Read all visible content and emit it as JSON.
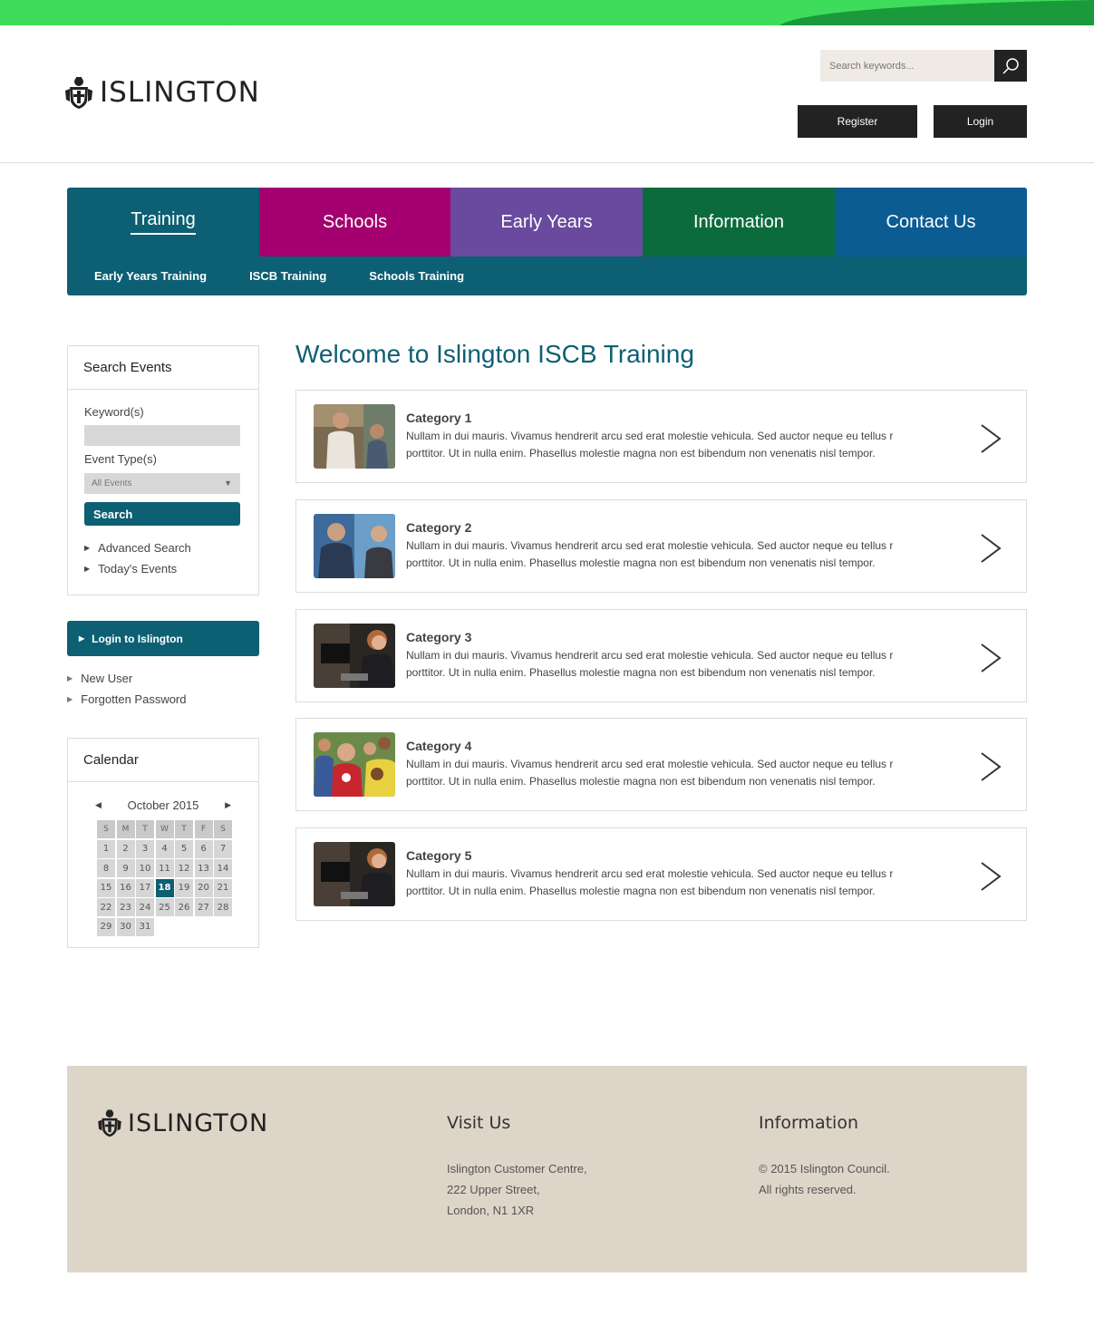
{
  "header": {
    "logo_text": "ISLINGTON",
    "search_placeholder": "Search keywords...",
    "register_label": "Register",
    "login_label": "Login"
  },
  "nav": {
    "tabs": [
      {
        "label": "Training",
        "color": "#0d5f73",
        "active": true
      },
      {
        "label": "Schools",
        "color": "#a4006f"
      },
      {
        "label": "Early Years",
        "color": "#6a4a9e"
      },
      {
        "label": "Information",
        "color": "#0c6b3d"
      },
      {
        "label": "Contact Us",
        "color": "#0c5c94"
      }
    ],
    "subnav": [
      "Early Years Training",
      "ISCB Training",
      "Schools Training"
    ]
  },
  "search_events": {
    "title": "Search Events",
    "keyword_label": "Keyword(s)",
    "event_type_label": "Event Type(s)",
    "event_type_value": "All Events",
    "search_button": "Search",
    "links": [
      "Advanced Search",
      "Today's Events"
    ]
  },
  "login_panel": {
    "button": "Login to Islington",
    "links": [
      "New User",
      "Forgotten Password"
    ]
  },
  "calendar": {
    "title": "Calendar",
    "month": "October 2015",
    "weekdays": [
      "S",
      "M",
      "T",
      "W",
      "T",
      "F",
      "S"
    ],
    "days": [
      "1",
      "2",
      "3",
      "4",
      "5",
      "6",
      "7",
      "8",
      "9",
      "10",
      "11",
      "12",
      "13",
      "14",
      "15",
      "16",
      "17",
      "18",
      "19",
      "20",
      "21",
      "22",
      "23",
      "24",
      "25",
      "26",
      "27",
      "28",
      "29",
      "30",
      "31"
    ],
    "selected_day": "18"
  },
  "main": {
    "title": "Welcome to Islington ISCB Training",
    "categories": [
      {
        "title": "Category 1",
        "desc": "Nullam in dui mauris. Vivamus hendrerit arcu sed erat molestie vehicula. Sed auctor neque eu tellus r porttitor. Ut in nulla enim. Phasellus molestie magna non est bibendum non venenatis nisl tempor."
      },
      {
        "title": "Category 2",
        "desc": "Nullam in dui mauris. Vivamus hendrerit arcu sed erat molestie vehicula. Sed auctor neque eu tellus r porttitor. Ut in nulla enim. Phasellus molestie magna non est bibendum non venenatis nisl tempor."
      },
      {
        "title": "Category 3",
        "desc": "Nullam in dui mauris. Vivamus hendrerit arcu sed erat molestie vehicula. Sed auctor neque eu tellus r porttitor. Ut in nulla enim. Phasellus molestie magna non est bibendum non venenatis nisl tempor."
      },
      {
        "title": "Category 4",
        "desc": "Nullam in dui mauris. Vivamus hendrerit arcu sed erat molestie vehicula. Sed auctor neque eu tellus r porttitor. Ut in nulla enim. Phasellus molestie magna non est bibendum non venenatis nisl tempor."
      },
      {
        "title": "Category 5",
        "desc": "Nullam in dui mauris. Vivamus hendrerit arcu sed erat molestie vehicula. Sed auctor neque eu tellus r porttitor. Ut in nulla enim. Phasellus molestie magna non est bibendum non venenatis nisl tempor."
      }
    ]
  },
  "footer": {
    "logo_text": "ISLINGTON",
    "visit_title": "Visit Us",
    "visit_lines": [
      "Islington Customer Centre,",
      "222 Upper Street,",
      "London, N1 1XR"
    ],
    "info_title": "Information",
    "info_lines": [
      "© 2015 Islington Council.",
      "All rights reserved."
    ]
  },
  "colors": {
    "accent": "#0d5f73",
    "top_band": "#3ddc5a",
    "footer_bg": "#ded5c9"
  }
}
